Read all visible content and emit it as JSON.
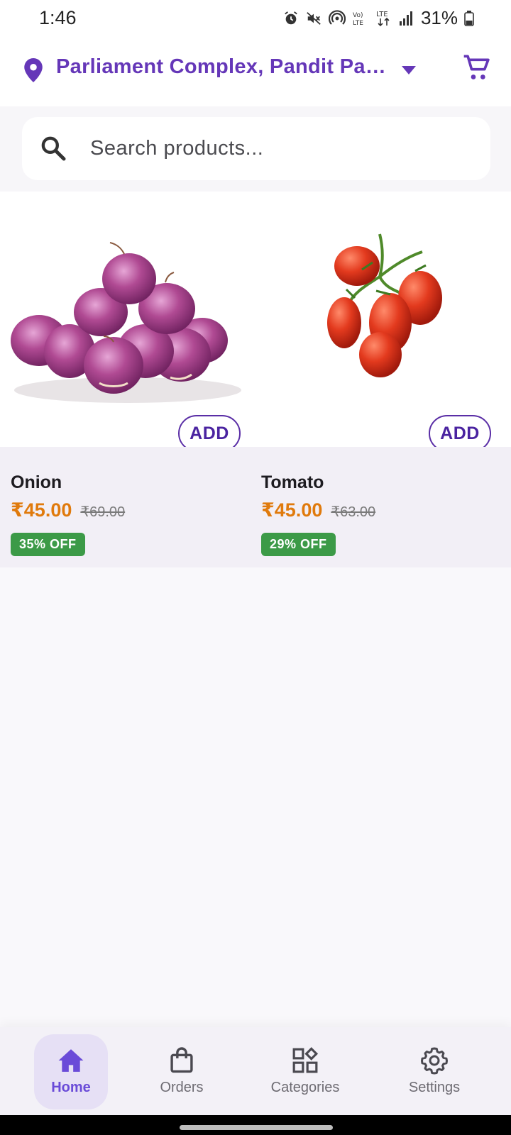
{
  "status_bar": {
    "time": "1:46",
    "battery": "31%",
    "icons": [
      "alarm-icon",
      "mute-icon",
      "hotspot-icon",
      "volte-icon",
      "lte-icon",
      "signal-icon",
      "battery-icon"
    ]
  },
  "header": {
    "location": "Parliament Complex, Pandit Pant Marg",
    "location_icon": "location-pin-icon",
    "cart_icon": "cart-icon",
    "accent_color": "#6537b8"
  },
  "search": {
    "placeholder": "Search products..."
  },
  "products": [
    {
      "name": "Onion",
      "price": "₹45.00",
      "mrp": "₹69.00",
      "discount": "35% OFF",
      "add_label": "ADD"
    },
    {
      "name": "Tomato",
      "price": "₹45.00",
      "mrp": "₹63.00",
      "discount": "29% OFF",
      "add_label": "ADD"
    }
  ],
  "bottom_nav": {
    "items": [
      {
        "label": "Home",
        "icon": "home-icon",
        "active": true
      },
      {
        "label": "Orders",
        "icon": "shopping-bag-icon",
        "active": false
      },
      {
        "label": "Categories",
        "icon": "categories-icon",
        "active": false
      },
      {
        "label": "Settings",
        "icon": "gear-icon",
        "active": false
      }
    ]
  },
  "colors": {
    "price": "#e07a0c",
    "discount_badge": "#3c9a47",
    "nav_active": "#6a4bd8"
  }
}
